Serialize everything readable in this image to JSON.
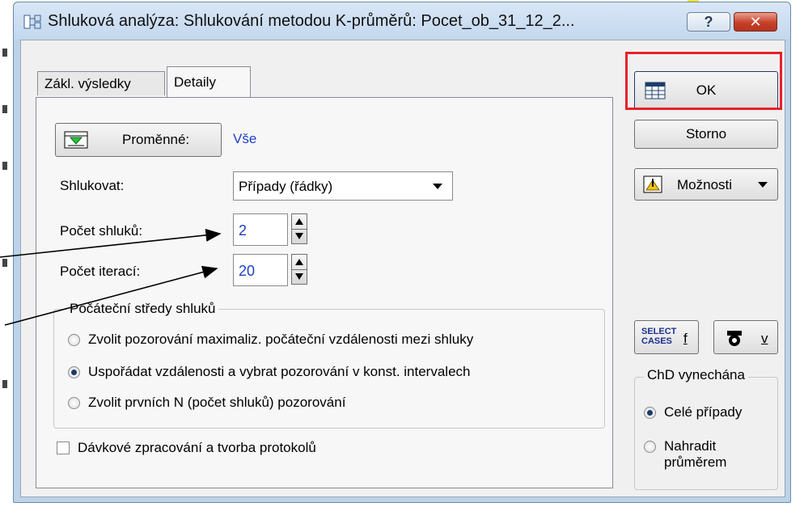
{
  "window": {
    "title": "Shluková analýza: Shlukování metodou K-průměrů: Pocet_ob_31_12_2...",
    "help_label": "?",
    "close_label": "✕"
  },
  "tabs": [
    {
      "label": "Zákl. výsledky",
      "active": false
    },
    {
      "label": "Detaily",
      "active": true
    }
  ],
  "details": {
    "variables_button": "Proměnné:",
    "variables_value": "Vše",
    "cluster_label": "Shlukovat:",
    "cluster_value": "Případy (řádky)",
    "num_clusters_label": "Počet shluků:",
    "num_clusters_value": "2",
    "num_iterations_label": "Počet iterací:",
    "num_iterations_value": "20",
    "initial_centers_title": "Počáteční středy shluků",
    "initial_centers_options": [
      {
        "label": "Zvolit pozorování maximaliz. počáteční vzdálenosti mezi shluky",
        "selected": false
      },
      {
        "label": "Uspořádat vzdálenosti a vybrat pozorování v konst. intervalech",
        "selected": true
      },
      {
        "label": "Zvolit prvních N (počet shluků) pozorování",
        "selected": false
      }
    ],
    "batch_label": "Dávkové zpracování a tvorba protokolů",
    "batch_checked": false
  },
  "actions": {
    "ok_label": "OK",
    "cancel_label": "Storno",
    "options_label": "Možnosti",
    "select_cases_icon_text": "SELECT CASES",
    "select_cases_label": "f",
    "weight_label": "v"
  },
  "missing_data": {
    "title": "ChD vynechána",
    "options": [
      {
        "label": "Celé případy",
        "selected": true
      },
      {
        "label": "Nahradit průměrem",
        "selected": false
      }
    ]
  },
  "colors": {
    "accent_blue": "#1f3fc4",
    "highlight_red": "#e8212a",
    "close_red": "#c6402a"
  }
}
